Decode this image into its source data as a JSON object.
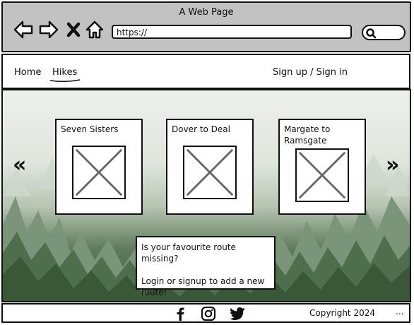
{
  "browser": {
    "window_title": "A Web Page",
    "url": "https://"
  },
  "nav": {
    "home_label": "Home",
    "hikes_label": "Hikes",
    "auth_label": "Sign up / Sign in"
  },
  "carousel": {
    "prev_label": "«",
    "next_label": "»",
    "cards": [
      {
        "title": "Seven Sisters"
      },
      {
        "title": "Dover to Deal"
      },
      {
        "title": "Margate to Ramsgate"
      }
    ]
  },
  "notice": {
    "line1": "Is your favourite route missing?",
    "line2": "Login or signup to add a new route!"
  },
  "footer": {
    "icons": [
      "facebook-icon",
      "instagram-icon",
      "twitter-icon"
    ],
    "copyright": "Copyright 2024",
    "more": "..."
  },
  "colors": {
    "browser_chrome": "#c2c2c2",
    "border": "#111111",
    "forest_dark": "#3f5e3c"
  }
}
